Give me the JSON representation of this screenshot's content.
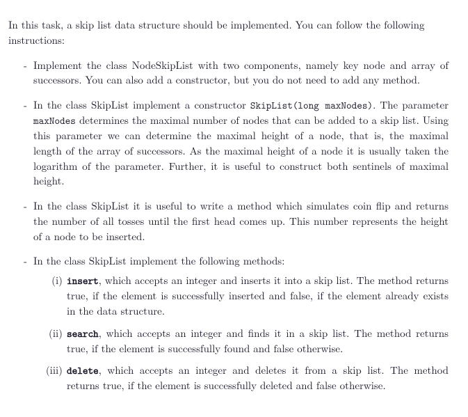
{
  "intro": "In this task, a skip list data structure should be implemented. You can follow the following instructions:",
  "bullet1": "Implement the class NodeSkipList with two components, namely key node and array of successors. You can also add a constructor, but you do not need to add any method.",
  "bullet2": {
    "a": "In the class SkipList implement a constructor ",
    "ctor": "SkipList(long maxNodes)",
    "b": ". The parameter ",
    "param": "maxNodes",
    "c": " determines the maximal number of nodes that can be added to a skip list. Using this parameter we can determine the maximal height of a node, that is, the maximal length of the array of successors. As the maximal height of a node it is usually taken the logarithm of the parameter. Further, it is useful to construct both sentinels of maximal height."
  },
  "bullet3": "In the class SkipList it is useful to write a method which simulates coin flip and returns the number of all tosses until the first head comes up. This number represents the height of a node to be inserted.",
  "bullet4_intro": "In the class SkipList implement the following methods:",
  "methods": {
    "m1": {
      "num": "(i)",
      "name": "insert",
      "desc": ", which accepts an integer and inserts it into a skip list. The method returns true, if the element is successfully inserted and false, if the element already exists in the data structure."
    },
    "m2": {
      "num": "(ii)",
      "name": "search",
      "desc": ", which accepts an integer and finds it in a skip list. The method returns true, if the element is successfully found and false otherwise."
    },
    "m3": {
      "num": "(iii)",
      "name": "delete",
      "desc": ", which accepts an integer and deletes it from a skip list. The method returns true, if the element is successfully deleted and false otherwise."
    }
  }
}
